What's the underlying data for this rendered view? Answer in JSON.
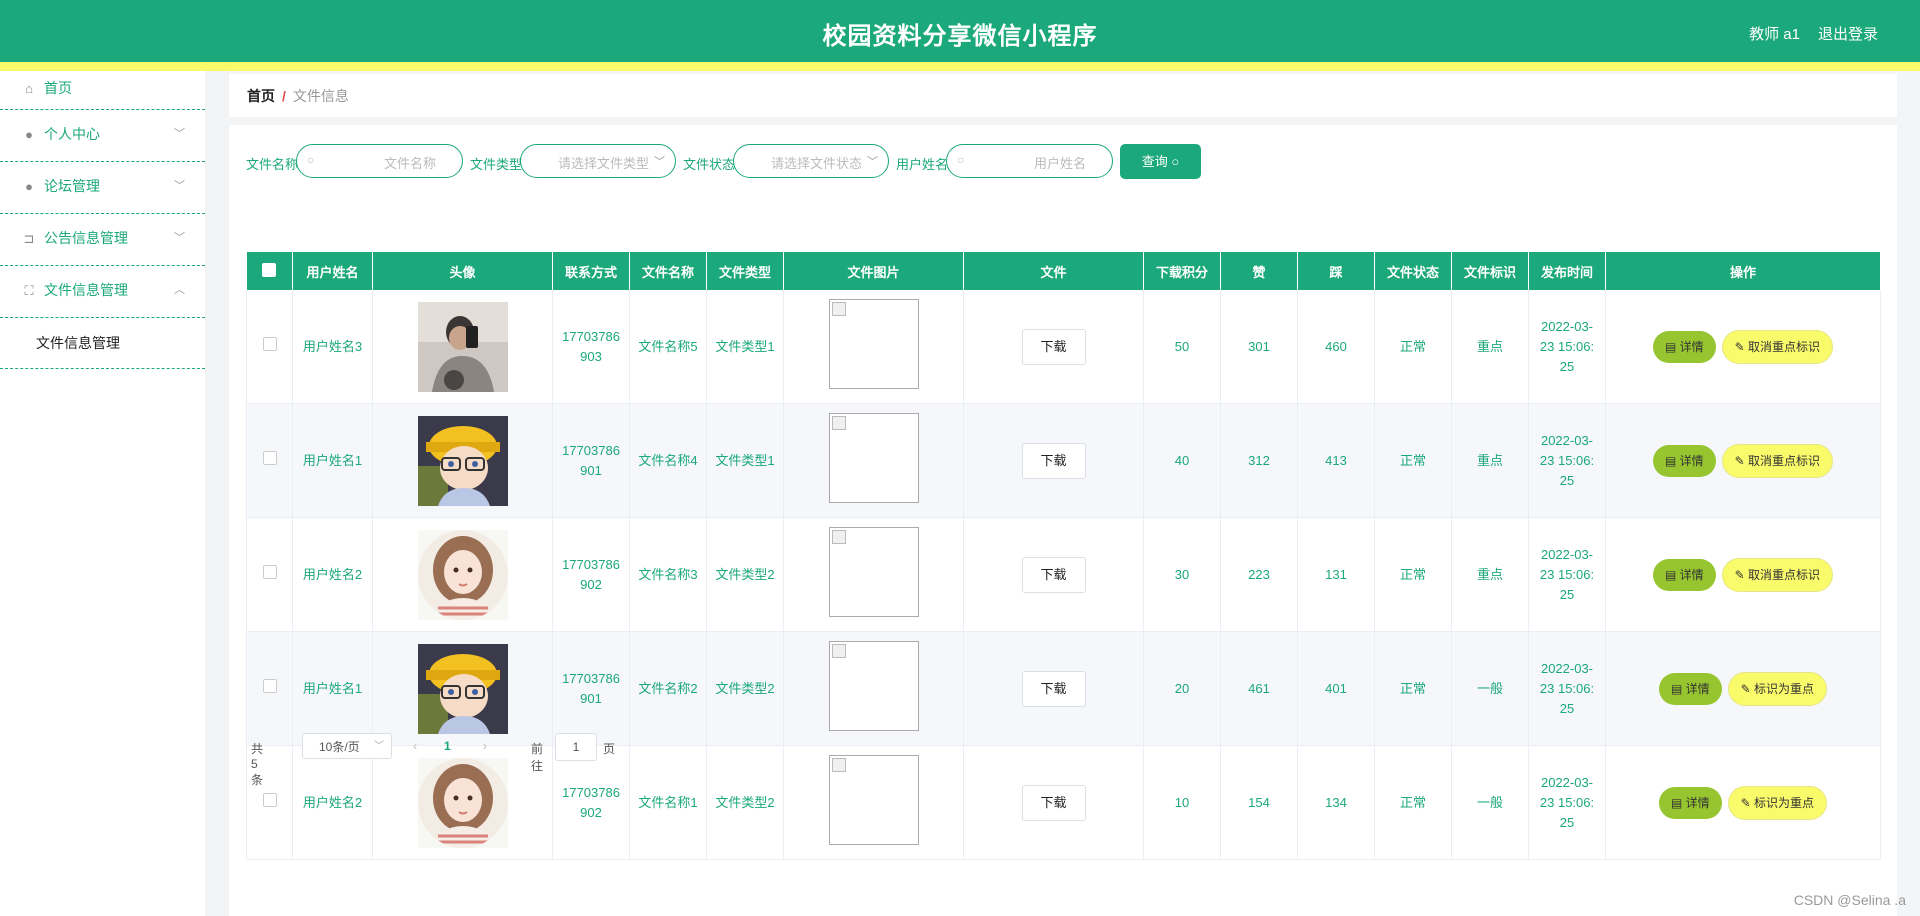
{
  "header": {
    "title": "校园资料分享微信小程序",
    "user": "教师 a1",
    "logout": "退出登录"
  },
  "sidebar": {
    "items": [
      {
        "label": "首页",
        "icon": "home-icon"
      },
      {
        "label": "个人中心",
        "icon": "user-icon"
      },
      {
        "label": "论坛管理",
        "icon": "bulb-icon"
      },
      {
        "label": "公告信息管理",
        "icon": "crop-icon"
      },
      {
        "label": "文件信息管理",
        "icon": "fullscreen-icon"
      }
    ],
    "sub_item": "文件信息管理"
  },
  "breadcrumb": {
    "home": "首页",
    "separator": "/",
    "current": "文件信息"
  },
  "filters": {
    "file_name_label": "文件名称",
    "file_name_placeholder": "文件名称",
    "file_type_label": "文件类型",
    "file_type_placeholder": "请选择文件类型",
    "file_status_label": "文件状态",
    "file_status_placeholder": "请选择文件状态",
    "user_name_label": "用户姓名",
    "user_name_placeholder": "用户姓名",
    "search_button": "查询"
  },
  "table": {
    "columns": [
      "用户姓名",
      "头像",
      "联系方式",
      "文件名称",
      "文件类型",
      "文件图片",
      "文件",
      "下载积分",
      "赞",
      "踩",
      "文件状态",
      "文件标识",
      "发布时间",
      "操作"
    ],
    "download_label": "下载",
    "detail_label": "详情",
    "rows": [
      {
        "user": "用户姓名3",
        "avatar": "photo-man",
        "phone": "17703786903",
        "file_name": "文件名称5",
        "file_type": "文件类型1",
        "points": "50",
        "likes": "301",
        "dislikes": "460",
        "status": "正常",
        "tag": "重点",
        "time": "2022-03-23 15:06:25",
        "action": "取消重点标识"
      },
      {
        "user": "用户姓名1",
        "avatar": "anime-boy",
        "phone": "17703786901",
        "file_name": "文件名称4",
        "file_type": "文件类型1",
        "points": "40",
        "likes": "312",
        "dislikes": "413",
        "status": "正常",
        "tag": "重点",
        "time": "2022-03-23 15:06:25",
        "action": "取消重点标识"
      },
      {
        "user": "用户姓名2",
        "avatar": "anime-girl",
        "phone": "17703786902",
        "file_name": "文件名称3",
        "file_type": "文件类型2",
        "points": "30",
        "likes": "223",
        "dislikes": "131",
        "status": "正常",
        "tag": "重点",
        "time": "2022-03-23 15:06:25",
        "action": "取消重点标识"
      },
      {
        "user": "用户姓名1",
        "avatar": "anime-boy",
        "phone": "17703786901",
        "file_name": "文件名称2",
        "file_type": "文件类型2",
        "points": "20",
        "likes": "461",
        "dislikes": "401",
        "status": "正常",
        "tag": "一般",
        "time": "2022-03-23 15:06:25",
        "action": "标识为重点"
      },
      {
        "user": "用户姓名2",
        "avatar": "anime-girl",
        "phone": "17703786902",
        "file_name": "文件名称1",
        "file_type": "文件类型2",
        "points": "10",
        "likes": "154",
        "dislikes": "134",
        "status": "正常",
        "tag": "一般",
        "time": "2022-03-23 15:06:25",
        "action": "标识为重点"
      }
    ]
  },
  "pagination": {
    "total": "共 5 条",
    "page_size": "10条/页",
    "current_page": "1",
    "goto_label": "前往",
    "goto_value": "1",
    "page_unit": "页"
  },
  "watermark": "CSDN @Selina .a",
  "colors": {
    "primary": "#1ba87a",
    "accent_yellow": "#fafb6b",
    "detail_green": "#96c52f"
  }
}
